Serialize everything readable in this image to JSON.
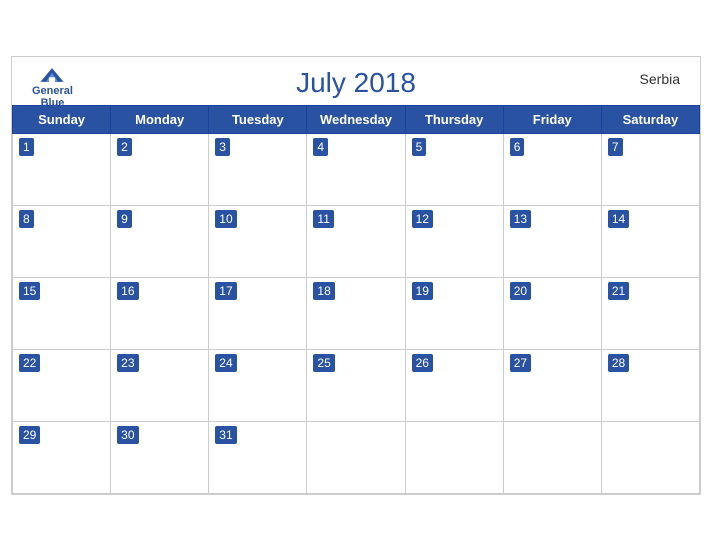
{
  "header": {
    "title": "July 2018",
    "country": "Serbia",
    "logo_general": "General",
    "logo_blue": "Blue"
  },
  "weekdays": [
    "Sunday",
    "Monday",
    "Tuesday",
    "Wednesday",
    "Thursday",
    "Friday",
    "Saturday"
  ],
  "weeks": [
    [
      1,
      2,
      3,
      4,
      5,
      6,
      7
    ],
    [
      8,
      9,
      10,
      11,
      12,
      13,
      14
    ],
    [
      15,
      16,
      17,
      18,
      19,
      20,
      21
    ],
    [
      22,
      23,
      24,
      25,
      26,
      27,
      28
    ],
    [
      29,
      30,
      31,
      null,
      null,
      null,
      null
    ]
  ]
}
